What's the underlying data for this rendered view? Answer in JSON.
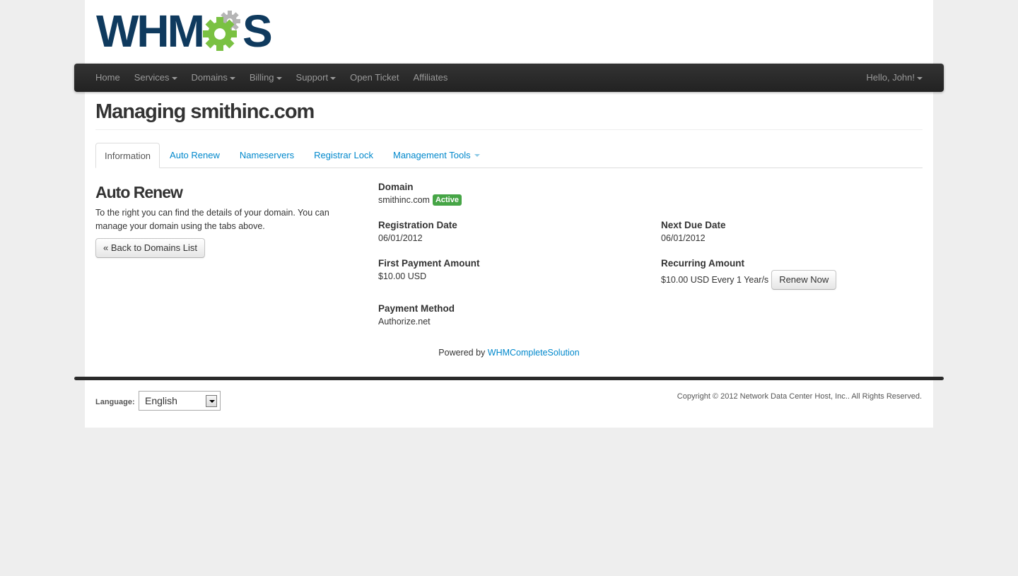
{
  "brand": {
    "logo_prefix": "WHM",
    "logo_suffix": "S",
    "colors": {
      "primary": "#0f3a5e",
      "gear_green": "#7ac142",
      "gear_gray": "#b5b5b5"
    }
  },
  "nav": {
    "items": [
      {
        "label": "Home",
        "dropdown": false
      },
      {
        "label": "Services",
        "dropdown": true
      },
      {
        "label": "Domains",
        "dropdown": true
      },
      {
        "label": "Billing",
        "dropdown": true
      },
      {
        "label": "Support",
        "dropdown": true
      },
      {
        "label": "Open Ticket",
        "dropdown": false
      },
      {
        "label": "Affiliates",
        "dropdown": false
      }
    ],
    "user": "Hello, John!"
  },
  "page": {
    "title": "Managing smithinc.com"
  },
  "tabs": [
    {
      "label": "Information",
      "active": true
    },
    {
      "label": "Auto Renew",
      "active": false
    },
    {
      "label": "Nameservers",
      "active": false
    },
    {
      "label": "Registrar Lock",
      "active": false
    },
    {
      "label": "Management Tools",
      "active": false
    }
  ],
  "sidebar": {
    "title": "Auto Renew",
    "text": "To the right you can find the details of your domain. You can manage your domain using the tabs above.",
    "back_button": "« Back to Domains List"
  },
  "details": {
    "domain": {
      "label": "Domain",
      "value": "smithinc.com",
      "status": "Active",
      "status_color": "#46a546"
    },
    "registration_date": {
      "label": "Registration Date",
      "value": "06/01/2012"
    },
    "next_due_date": {
      "label": "Next Due Date",
      "value": "06/01/2012"
    },
    "first_payment": {
      "label": "First Payment Amount",
      "value": "$10.00 USD"
    },
    "recurring": {
      "label": "Recurring Amount",
      "value": "$10.00 USD Every 1 Year/s",
      "renew_button": "Renew Now"
    },
    "payment_method": {
      "label": "Payment Method",
      "value": "Authorize.net"
    }
  },
  "powered": {
    "prefix": "Powered by",
    "link": "WHMCompleteSolution"
  },
  "footer": {
    "language_label": "Language:",
    "language_value": "English",
    "copyright": "Copyright © 2012 Network Data Center Host, Inc.. All Rights Reserved."
  }
}
